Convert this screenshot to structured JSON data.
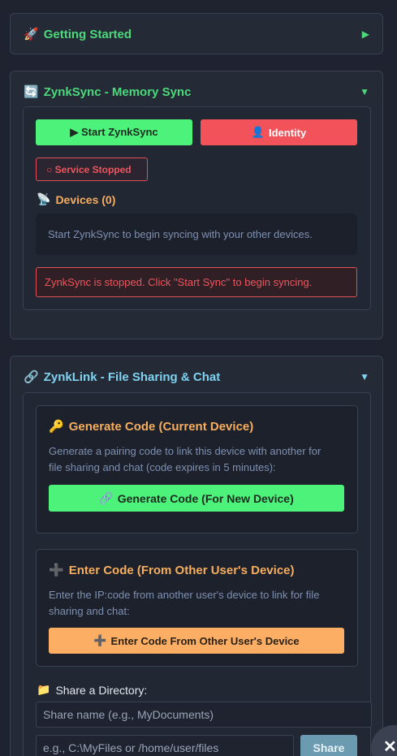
{
  "getting_started": {
    "icon": "🚀",
    "title": "Getting Started",
    "toggle": "▶"
  },
  "zynksync": {
    "icon": "🔄",
    "title": "ZynkSync - Memory Sync",
    "toggle": "▼",
    "start_label": "▶ Start ZynkSync",
    "identity_icon": "👤",
    "identity_label": "Identity",
    "status": "○ Service Stopped",
    "devices_icon": "📡",
    "devices_label": "Devices (0)",
    "devices_empty": "Start ZynkSync to begin syncing with your other devices.",
    "alert": "ZynkSync is stopped. Click \"Start Sync\" to begin syncing."
  },
  "zynklink": {
    "icon": "🔗",
    "title": "ZynkLink - File Sharing & Chat",
    "toggle": "▼",
    "generate": {
      "icon": "🔑",
      "title": "Generate Code (Current Device)",
      "desc_line1": "Generate a pairing code to link this device with another for",
      "desc_line2": "file sharing and chat (code expires in 5 minutes):",
      "button_icon": "🔗",
      "button_label": "Generate Code (For New Device)"
    },
    "enter": {
      "icon": "➕",
      "title": "Enter Code (From Other User's Device)",
      "desc_line1": "Enter the IP:code from another user's device to link for file",
      "desc_line2": "sharing and chat:",
      "button_icon": "➕",
      "button_label": "Enter Code From Other User's Device"
    },
    "share": {
      "icon": "📁",
      "label": "Share a Directory:",
      "name_placeholder": "Share name (e.g., MyDocuments)",
      "path_placeholder": "e.g., C:\\MyFiles or /home/user/files",
      "button_label": "Share"
    }
  },
  "close_label": "✕",
  "colors": {
    "accent_green": "#4cf27a",
    "accent_red": "#f2525a",
    "accent_orange": "#fbae64",
    "title_cyan": "#7fd3f0"
  }
}
